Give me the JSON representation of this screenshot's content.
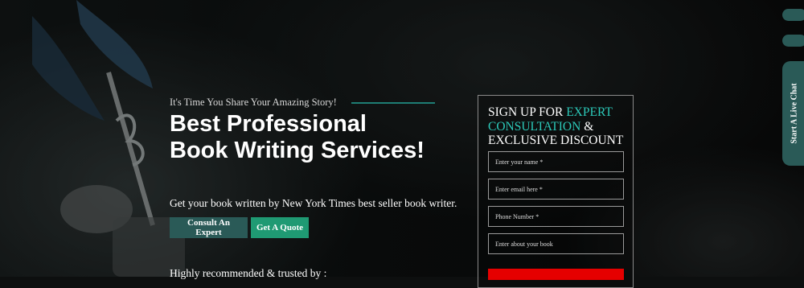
{
  "hero": {
    "tagline": "It's Time You Share Your Amazing Story!",
    "title": "Best Professional Book Writing Services!",
    "subtitle": "Get your book written by New York Times best seller book writer.",
    "consult_button": "Consult An Expert",
    "quote_button": "Get A Quote",
    "trusted_text": "Highly recommended & trusted by :"
  },
  "form": {
    "heading_1": "SIGN UP FOR ",
    "heading_accent": "EXPERT CONSULTATION",
    "heading_2": " & EXCLUSIVE DISCOUNT",
    "name_placeholder": "Enter your name *",
    "email_placeholder": "Enter email here *",
    "phone_placeholder": "Phone Number *",
    "book_placeholder": "Enter about your book"
  },
  "widgets": {
    "live_chat_label": "Start A Live Chat"
  },
  "colors": {
    "accent": "#2cc9b9",
    "primary_button": "#2a5a57",
    "secondary_button": "#1f9a73",
    "submit": "#e50000"
  }
}
